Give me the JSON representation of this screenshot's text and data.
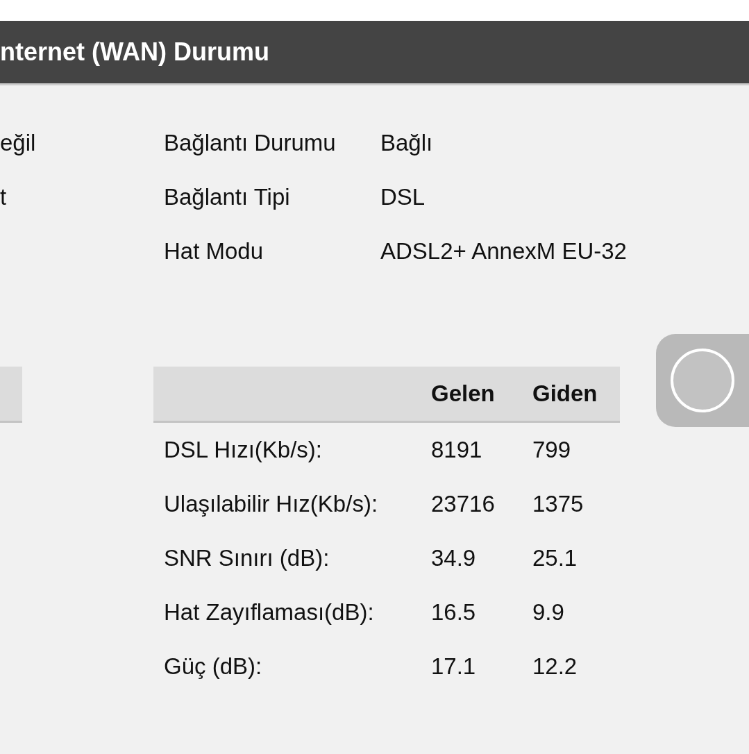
{
  "header": {
    "title": "nternet (WAN) Durumu"
  },
  "left_column": {
    "values": [
      "eğil",
      "t"
    ]
  },
  "status": [
    {
      "label": "Bağlantı Durumu",
      "value": "Bağlı"
    },
    {
      "label": "Bağlantı Tipi",
      "value": "DSL"
    },
    {
      "label": "Hat Modu",
      "value": "ADSL2+ AnnexM EU-32"
    }
  ],
  "dsl_table": {
    "columns": [
      "",
      "Gelen",
      "Giden"
    ],
    "rows": [
      [
        "DSL Hızı(Kb/s):",
        "8191",
        "799"
      ],
      [
        "Ulaşılabilir Hız(Kb/s):",
        "23716",
        "1375"
      ],
      [
        "SNR Sınırı (dB):",
        "34.9",
        "25.1"
      ],
      [
        "Hat Zayıflaması(dB):",
        "16.5",
        "9.9"
      ],
      [
        "Güç (dB):",
        "17.1",
        "12.2"
      ]
    ]
  }
}
